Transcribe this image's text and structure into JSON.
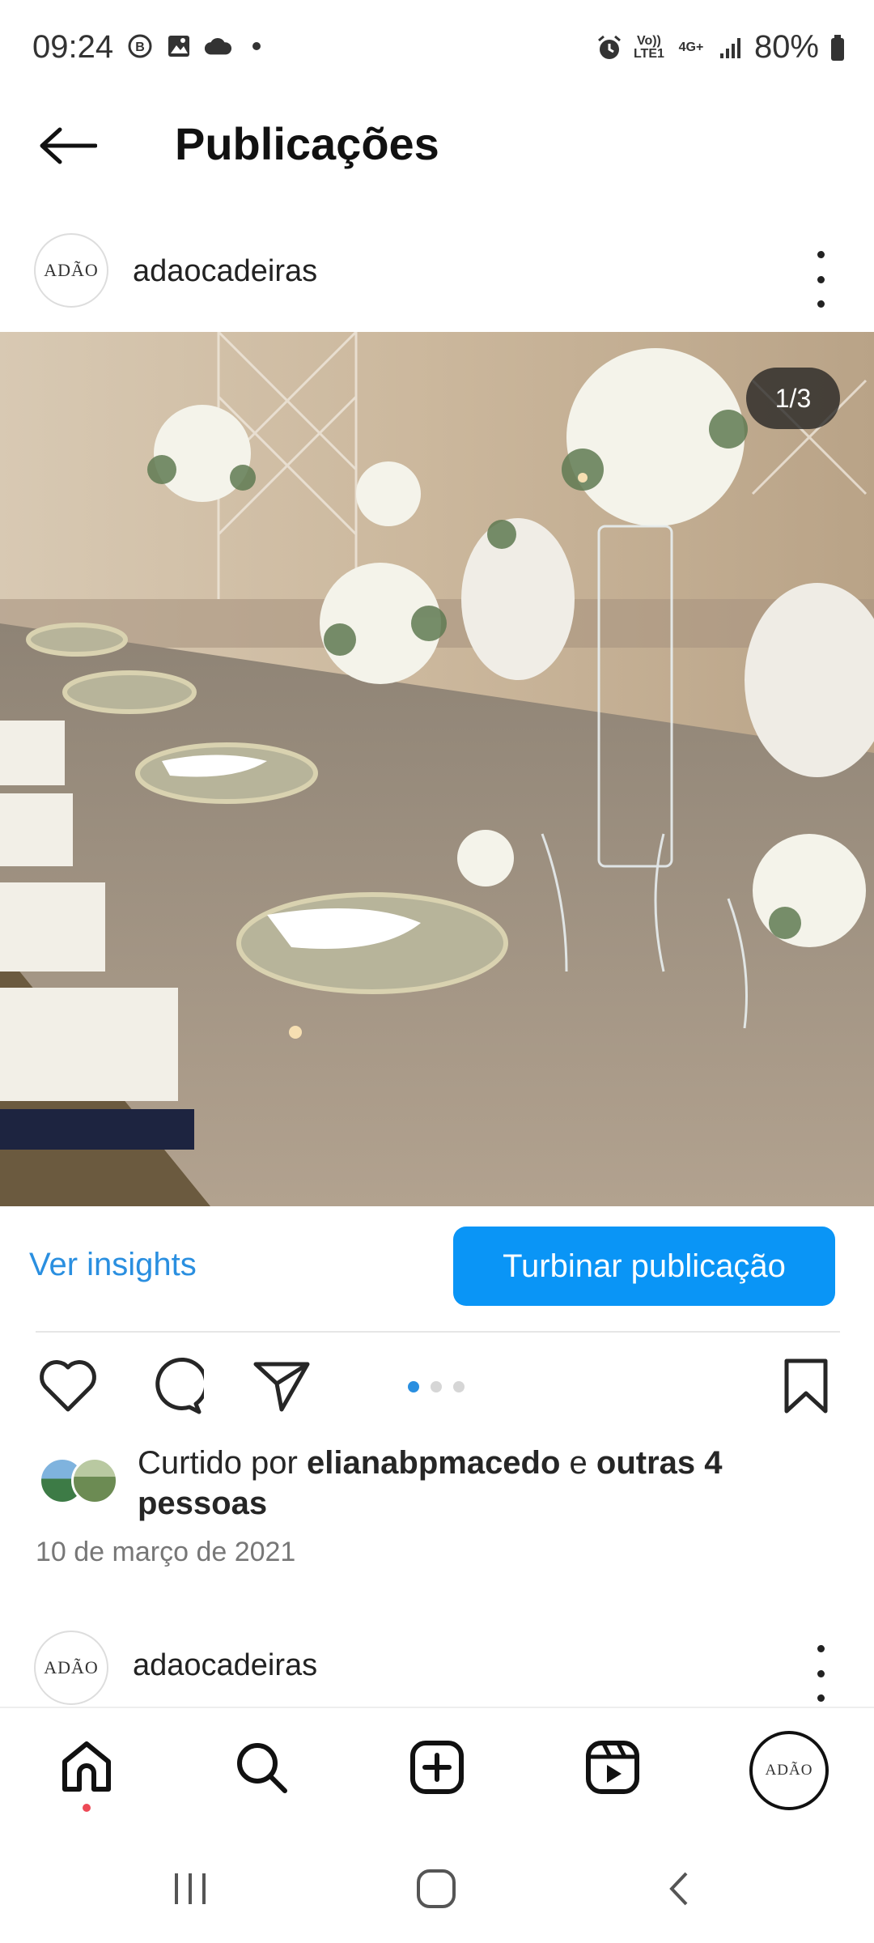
{
  "status_bar": {
    "time": "09:24",
    "network_top": "Vo)) LTE1",
    "network_gen": "4G+",
    "battery": "80%"
  },
  "header": {
    "title": "Publicações"
  },
  "post": {
    "username": "adaocadeiras",
    "avatar_text": "ADÃO",
    "image_counter": "1/3",
    "insights_label": "Ver insights",
    "boost_label": "Turbinar publicação",
    "likes": {
      "prefix": "Curtido por ",
      "user": "elianabpmacedo",
      "conj": " e ",
      "others": "outras 4 pessoas"
    },
    "date": "10 de março de 2021"
  },
  "next_post": {
    "username": "adaocadeiras",
    "avatar_text": "ADÃO"
  },
  "bottom_nav": {
    "profile_avatar_text": "ADÃO"
  },
  "colors": {
    "accent": "#0a95f6",
    "link": "#2a8fe0",
    "notification": "#ed4956"
  }
}
